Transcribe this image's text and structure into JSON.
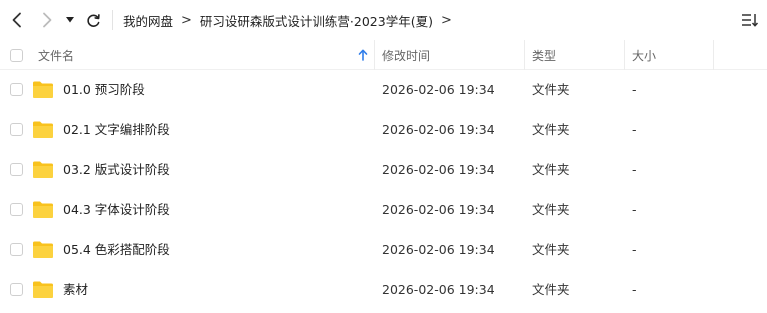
{
  "breadcrumb": {
    "items": [
      "我的网盘",
      "研习设研森版式设计训练营·2023学年(夏)"
    ]
  },
  "header": {
    "name": "文件名",
    "modified": "修改时间",
    "type": "类型",
    "size": "大小"
  },
  "files": [
    {
      "name": "01.0 预习阶段",
      "modified": "2026-02-06 19:34",
      "type": "文件夹",
      "size": "-"
    },
    {
      "name": "02.1 文字编排阶段",
      "modified": "2026-02-06 19:34",
      "type": "文件夹",
      "size": "-"
    },
    {
      "name": "03.2 版式设计阶段",
      "modified": "2026-02-06 19:34",
      "type": "文件夹",
      "size": "-"
    },
    {
      "name": "04.3 字体设计阶段",
      "modified": "2026-02-06 19:34",
      "type": "文件夹",
      "size": "-"
    },
    {
      "name": "05.4 色彩搭配阶段",
      "modified": "2026-02-06 19:34",
      "type": "文件夹",
      "size": "-"
    },
    {
      "name": "素材",
      "modified": "2026-02-06 19:34",
      "type": "文件夹",
      "size": "-"
    }
  ],
  "colors": {
    "folder": "#f8c21d",
    "sort_arrow": "#2f7dea"
  },
  "icons": {
    "back": "chevron-left-icon",
    "forward": "chevron-right-icon",
    "dropdown": "caret-down-icon",
    "refresh": "refresh-icon",
    "sort": "sort-list-icon",
    "folder": "folder-icon"
  }
}
